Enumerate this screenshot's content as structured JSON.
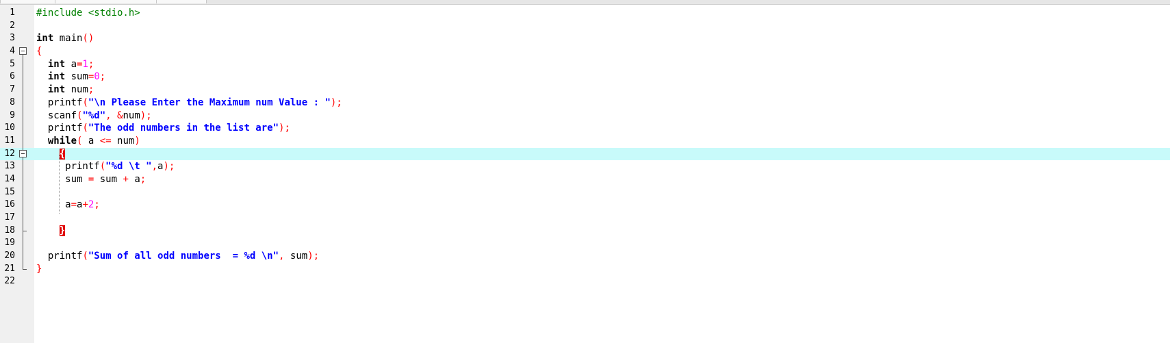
{
  "editor": {
    "current_line": 12,
    "lines": [
      {
        "n": "1",
        "tokens": [
          {
            "t": "pre",
            "v": "#include <stdio.h>"
          }
        ]
      },
      {
        "n": "2",
        "tokens": []
      },
      {
        "n": "3",
        "tokens": [
          {
            "t": "kw",
            "v": "int"
          },
          {
            "t": "id",
            "v": " main"
          },
          {
            "t": "op",
            "v": "()"
          }
        ]
      },
      {
        "n": "4",
        "fold": "open",
        "tokens": [
          {
            "t": "op",
            "v": "{"
          }
        ]
      },
      {
        "n": "5",
        "fold": "mid",
        "tokens": [
          {
            "t": "id",
            "v": "  "
          },
          {
            "t": "kw",
            "v": "int"
          },
          {
            "t": "id",
            "v": " a"
          },
          {
            "t": "op",
            "v": "="
          },
          {
            "t": "num",
            "v": "1"
          },
          {
            "t": "op",
            "v": ";"
          }
        ]
      },
      {
        "n": "6",
        "fold": "mid",
        "tokens": [
          {
            "t": "id",
            "v": "  "
          },
          {
            "t": "kw",
            "v": "int"
          },
          {
            "t": "id",
            "v": " sum"
          },
          {
            "t": "op",
            "v": "="
          },
          {
            "t": "num",
            "v": "0"
          },
          {
            "t": "op",
            "v": ";"
          }
        ]
      },
      {
        "n": "7",
        "fold": "mid",
        "tokens": [
          {
            "t": "id",
            "v": "  "
          },
          {
            "t": "kw",
            "v": "int"
          },
          {
            "t": "id",
            "v": " num"
          },
          {
            "t": "op",
            "v": ";"
          }
        ]
      },
      {
        "n": "8",
        "fold": "mid",
        "tokens": [
          {
            "t": "id",
            "v": "  printf"
          },
          {
            "t": "op",
            "v": "("
          },
          {
            "t": "str",
            "v": "\"\\n Please Enter the Maximum num Value : \""
          },
          {
            "t": "op",
            "v": ");"
          }
        ]
      },
      {
        "n": "9",
        "fold": "mid",
        "tokens": [
          {
            "t": "id",
            "v": "  scanf"
          },
          {
            "t": "op",
            "v": "("
          },
          {
            "t": "str",
            "v": "\"%d\""
          },
          {
            "t": "op",
            "v": ", &"
          },
          {
            "t": "id",
            "v": "num"
          },
          {
            "t": "op",
            "v": ");"
          }
        ]
      },
      {
        "n": "10",
        "fold": "mid",
        "tokens": [
          {
            "t": "id",
            "v": "  printf"
          },
          {
            "t": "op",
            "v": "("
          },
          {
            "t": "str",
            "v": "\"The odd numbers in the list are\""
          },
          {
            "t": "op",
            "v": ");"
          }
        ]
      },
      {
        "n": "11",
        "fold": "mid",
        "tokens": [
          {
            "t": "id",
            "v": "  "
          },
          {
            "t": "kw",
            "v": "while"
          },
          {
            "t": "op",
            "v": "("
          },
          {
            "t": "id",
            "v": " a "
          },
          {
            "t": "op",
            "v": "<="
          },
          {
            "t": "id",
            "v": " num"
          },
          {
            "t": "op",
            "v": ")"
          }
        ]
      },
      {
        "n": "12",
        "fold": "open",
        "tokens": [
          {
            "t": "id",
            "v": "    "
          },
          {
            "t": "hl",
            "v": "{"
          }
        ]
      },
      {
        "n": "13",
        "fold": "mid",
        "tokens": [
          {
            "t": "id",
            "v": "     printf"
          },
          {
            "t": "op",
            "v": "("
          },
          {
            "t": "str",
            "v": "\"%d \\t \""
          },
          {
            "t": "op",
            "v": ","
          },
          {
            "t": "id",
            "v": "a"
          },
          {
            "t": "op",
            "v": ");"
          }
        ]
      },
      {
        "n": "14",
        "fold": "mid",
        "tokens": [
          {
            "t": "id",
            "v": "     sum "
          },
          {
            "t": "op",
            "v": "="
          },
          {
            "t": "id",
            "v": " sum "
          },
          {
            "t": "op",
            "v": "+"
          },
          {
            "t": "id",
            "v": " a"
          },
          {
            "t": "op",
            "v": ";"
          }
        ]
      },
      {
        "n": "15",
        "fold": "mid",
        "tokens": []
      },
      {
        "n": "16",
        "fold": "mid",
        "tokens": [
          {
            "t": "id",
            "v": "     a"
          },
          {
            "t": "op",
            "v": "="
          },
          {
            "t": "id",
            "v": "a"
          },
          {
            "t": "op",
            "v": "+"
          },
          {
            "t": "num",
            "v": "2"
          },
          {
            "t": "op",
            "v": ";"
          }
        ]
      },
      {
        "n": "17",
        "fold": "mid",
        "tokens": []
      },
      {
        "n": "18",
        "fold": "endinner",
        "tokens": [
          {
            "t": "id",
            "v": "    "
          },
          {
            "t": "hl",
            "v": "}"
          }
        ]
      },
      {
        "n": "19",
        "fold": "mid",
        "tokens": []
      },
      {
        "n": "20",
        "fold": "mid",
        "tokens": [
          {
            "t": "id",
            "v": "  printf"
          },
          {
            "t": "op",
            "v": "("
          },
          {
            "t": "str",
            "v": "\"Sum of all odd numbers  = %d \\n\""
          },
          {
            "t": "op",
            "v": ", "
          },
          {
            "t": "id",
            "v": "sum"
          },
          {
            "t": "op",
            "v": ");"
          }
        ]
      },
      {
        "n": "21",
        "fold": "end",
        "tokens": [
          {
            "t": "op",
            "v": "}"
          }
        ]
      },
      {
        "n": "22",
        "tokens": []
      }
    ]
  },
  "colors": {
    "keyword": "#000000",
    "preprocessor": "#008000",
    "operator": "#ff0000",
    "number": "#ff00ff",
    "string": "#0000ff",
    "current_line_bg": "#c8fafa",
    "brace_match_bg": "#e00000"
  },
  "icons": [
    "fold-minus-icon",
    "fold-line-icon",
    "fold-end-icon"
  ]
}
